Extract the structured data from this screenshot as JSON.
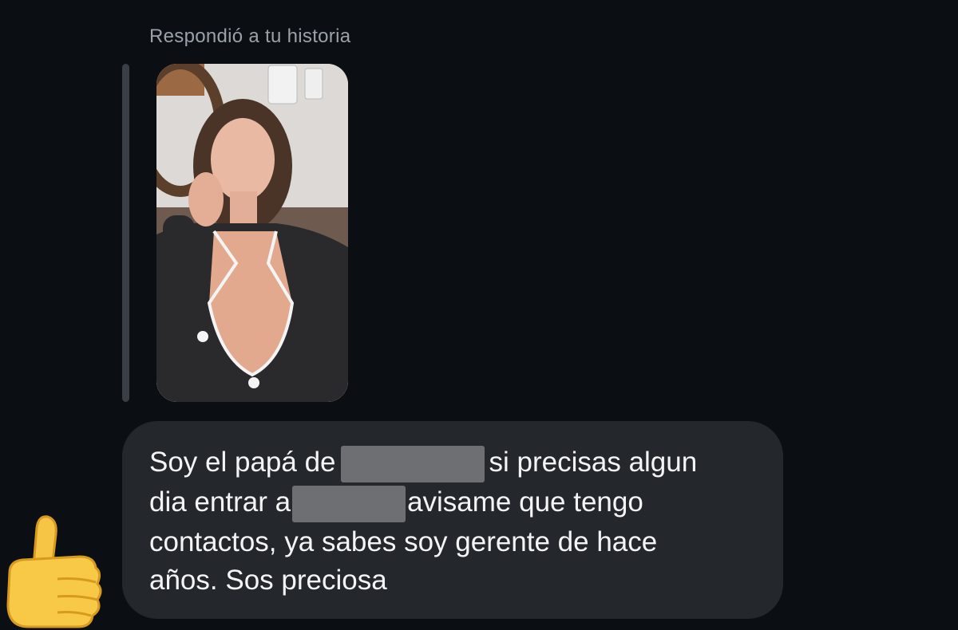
{
  "reply_header": {
    "caption": "Respondió a tu historia"
  },
  "story": {
    "description": "story image thumbnail"
  },
  "message": {
    "line1_before": "Soy el papá de",
    "line1_after": "si precisas algun",
    "line2_before": "dia entrar a",
    "line2_after": "avisame que tengo",
    "line3": "contactos, ya sabes soy gerente de hace",
    "line4": "años. Sos preciosa"
  },
  "reaction": {
    "icon": "thumbs-up-icon"
  },
  "colors": {
    "background": "#0b0f13",
    "bubble": "#24272c",
    "caption_text": "#9aa1a9",
    "message_text": "#f3f4f6",
    "redaction": "#6e6f72"
  }
}
